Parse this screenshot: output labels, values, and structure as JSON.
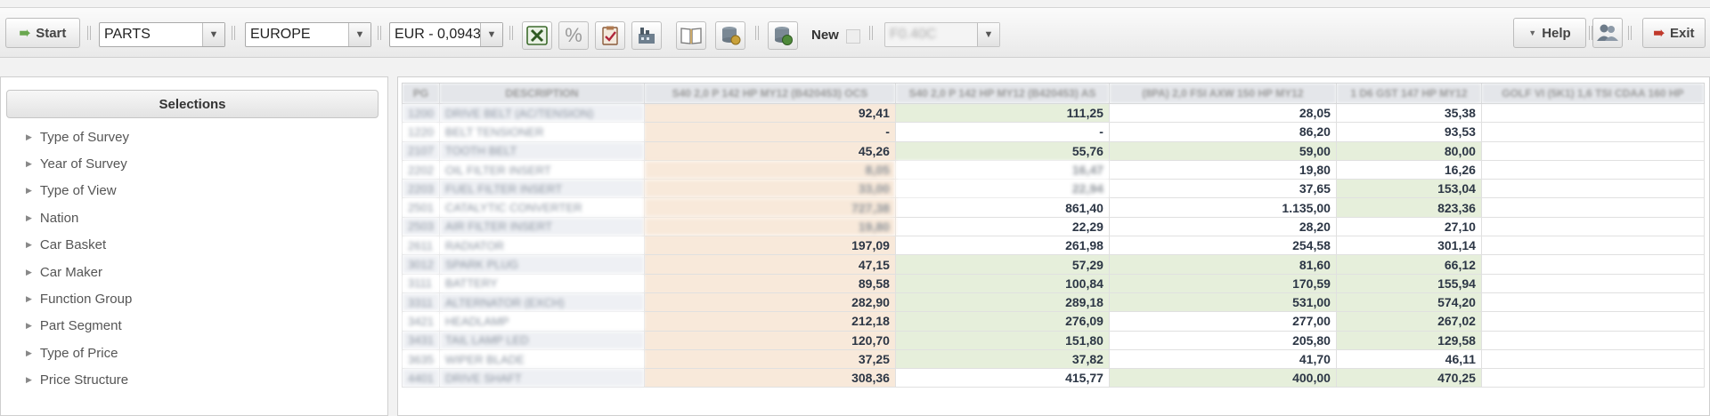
{
  "toolbar": {
    "start_label": "Start",
    "parts_value": "PARTS",
    "region_value": "EUROPE",
    "currency_value": "EUR - 0,0943",
    "percent_glyph": "%",
    "new_label": "New",
    "blurred_combo_value": "F0.40C",
    "help_label": "Help",
    "exit_label": "Exit",
    "colors": {
      "start_arrow": "#6aa84f",
      "exit_arrow": "#c0392b"
    }
  },
  "selections": {
    "title": "Selections",
    "items": [
      {
        "label": "Type of Survey"
      },
      {
        "label": "Year of Survey"
      },
      {
        "label": "Type of View"
      },
      {
        "label": "Nation"
      },
      {
        "label": "Car Basket"
      },
      {
        "label": "Car Maker"
      },
      {
        "label": "Function Group"
      },
      {
        "label": "Part Segment"
      },
      {
        "label": "Type of Price"
      },
      {
        "label": "Price Structure"
      }
    ]
  },
  "grid": {
    "headers": [
      "PG",
      "DESCRIPTION",
      "S40 2,0 P 142 HP MY12 (B420453) OCS",
      "S40 2,0 P 142 HP MY12 (B420453) AS",
      "(8PA) 2,0 FSI AXW 150 HP MY12",
      "1 D6 GST 147 HP MY12",
      "GOLF VI (5K1) 1,6 TSI CDAA 160 HP"
    ],
    "rows": [
      {
        "pg": "1200",
        "desc": "DRIVE BELT (AC/TENSION)",
        "v1": "92,41",
        "v2": "111,25",
        "v3": "28,05",
        "v4": "35,38"
      },
      {
        "pg": "1220",
        "desc": "BELT TENSIONER",
        "v1": "-",
        "v2": "-",
        "v3": "86,20",
        "v4": "93,53"
      },
      {
        "pg": "2107",
        "desc": "TOOTH BELT",
        "v1": "45,26",
        "v2": "55,76",
        "v3": "59,00",
        "v4": "80,00"
      },
      {
        "pg": "2202",
        "desc": "OIL FILTER INSERT",
        "v1": "8,05",
        "v2": "16,47",
        "v3": "19,80",
        "v4": "16,26"
      },
      {
        "pg": "2203",
        "desc": "FUEL FILTER INSERT",
        "v1": "33,00",
        "v2": "22,94",
        "v3": "37,65",
        "v4": "153,04"
      },
      {
        "pg": "2501",
        "desc": "CATALYTIC CONVERTER",
        "v1": "727,38",
        "v2": "861,40",
        "v3": "1.135,00",
        "v4": "823,36"
      },
      {
        "pg": "2503",
        "desc": "AIR FILTER INSERT",
        "v1": "19,80",
        "v2": "22,29",
        "v3": "28,20",
        "v4": "27,10"
      },
      {
        "pg": "2611",
        "desc": "RADIATOR",
        "v1": "197,09",
        "v2": "261,98",
        "v3": "254,58",
        "v4": "301,14"
      },
      {
        "pg": "3012",
        "desc": "SPARK PLUG",
        "v1": "47,15",
        "v2": "57,29",
        "v3": "81,60",
        "v4": "66,12"
      },
      {
        "pg": "3111",
        "desc": "BATTERY",
        "v1": "89,58",
        "v2": "100,84",
        "v3": "170,59",
        "v4": "155,94"
      },
      {
        "pg": "3311",
        "desc": "ALTERNATOR (EXCH)",
        "v1": "282,90",
        "v2": "289,18",
        "v3": "531,00",
        "v4": "574,20"
      },
      {
        "pg": "3421",
        "desc": "HEADLAMP",
        "v1": "212,18",
        "v2": "276,09",
        "v3": "277,00",
        "v4": "267,02"
      },
      {
        "pg": "3431",
        "desc": "TAIL LAMP LED",
        "v1": "120,70",
        "v2": "151,80",
        "v3": "205,80",
        "v4": "129,58"
      },
      {
        "pg": "3635",
        "desc": "WIPER BLADE",
        "v1": "37,25",
        "v2": "37,82",
        "v3": "41,70",
        "v4": "46,11"
      },
      {
        "pg": "4401",
        "desc": "DRIVE SHAFT",
        "v1": "308,36",
        "v2": "415,77",
        "v3": "400,00",
        "v4": "470,25"
      }
    ]
  }
}
